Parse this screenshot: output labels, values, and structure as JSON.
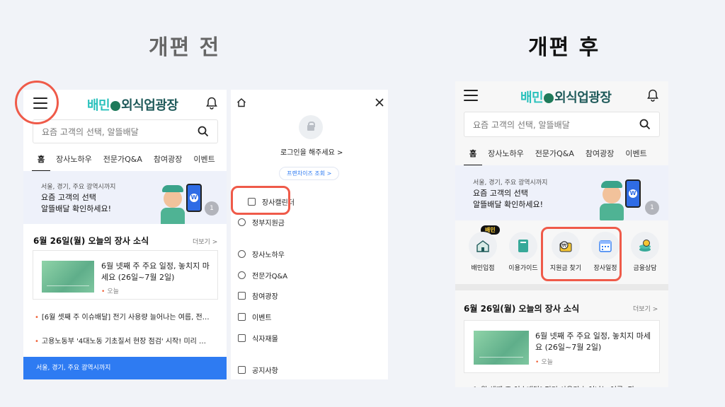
{
  "labels": {
    "before": "개편 전",
    "after": "개편 후"
  },
  "app": {
    "logo_part1": "배민",
    "logo_part2": "외식업광장",
    "search_placeholder": "요즘 고객의 선택, 알뜰배달",
    "tabs": [
      "홈",
      "장사노하우",
      "전문가Q&A",
      "참여광장",
      "이벤트"
    ],
    "banner_small": "서울, 경기, 주요 광역시까지",
    "banner_line1": "요즘 고객의 선택",
    "banner_line2": "알뜰배달 확인하세요!",
    "banner_pager": "1",
    "section_title": "6월 26일(월) 오늘의 장사 소식",
    "more": "더보기 >",
    "card_title": "6월 넷째 주 주요 일정, 놓치지 마세요 (26일~7월 2일)",
    "card_meta": "오늘",
    "news": [
      "[6월 셋째 주 이슈배달] 전기 사용량 늘어나는 여름, 전…",
      "고용노동부 '4대노동 기초질서 현장 점검' 시작! 미리 …"
    ],
    "blue_banner_text": "서울, 경기, 주요 광역시까지"
  },
  "drawer": {
    "login": "로그인을 해주세요 >",
    "franchise_pill": "프랜차이즈 조회 >",
    "items": [
      "장사캘린더",
      "정부지원금",
      "장사노하우",
      "전문가Q&A",
      "참여광장",
      "이벤트",
      "식자재몰",
      "공지사항"
    ]
  },
  "quick_menu": {
    "new_tag": "배민",
    "items": [
      "배민입점",
      "이용가이드",
      "지원금 찾기",
      "장사일정",
      "금융상담"
    ]
  },
  "colors": {
    "accent_red": "#ef5a49",
    "brand_mint": "#2ac1bc",
    "brand_blue": "#2e7bf2"
  }
}
